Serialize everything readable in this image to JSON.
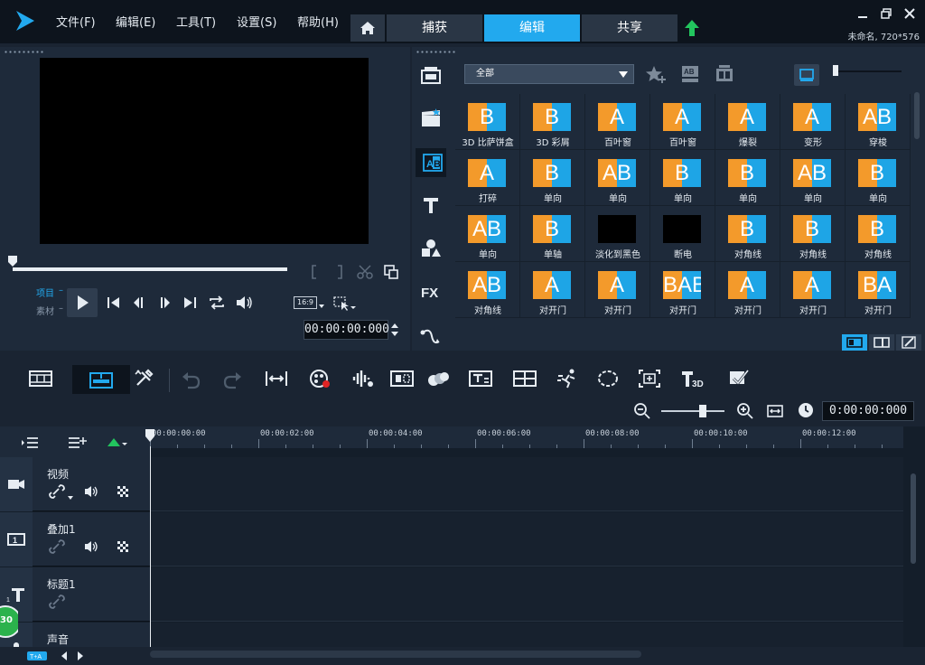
{
  "menu": {
    "file": "文件(F)",
    "edit": "编辑(E)",
    "tools": "工具(T)",
    "settings": "设置(S)",
    "help": "帮助(H)"
  },
  "tabs": {
    "capture": "捕获",
    "edit": "编辑",
    "share": "共享",
    "active": "edit"
  },
  "project": {
    "info": "未命名, 720*576"
  },
  "preview": {
    "mode_project": "项目",
    "mode_clip": "素材",
    "aspect_ratio": "16:9",
    "timecode": "00:00:00:000"
  },
  "library": {
    "category": "全部",
    "active_section": "transitions",
    "items": [
      {
        "label": "3D 比萨饼盒",
        "glyph": "B"
      },
      {
        "label": "3D 彩屑",
        "glyph": "B"
      },
      {
        "label": "百叶窗",
        "glyph": "A"
      },
      {
        "label": "百叶窗",
        "glyph": "A"
      },
      {
        "label": "爆裂",
        "glyph": "A"
      },
      {
        "label": "变形",
        "glyph": "A"
      },
      {
        "label": "穿梭",
        "glyph": "AB"
      },
      {
        "label": "打碎",
        "glyph": "A"
      },
      {
        "label": "单向",
        "glyph": "B"
      },
      {
        "label": "单向",
        "glyph": "AB"
      },
      {
        "label": "单向",
        "glyph": "B"
      },
      {
        "label": "单向",
        "glyph": "B"
      },
      {
        "label": "单向",
        "glyph": "AB"
      },
      {
        "label": "单向",
        "glyph": "B"
      },
      {
        "label": "单向",
        "glyph": "AB"
      },
      {
        "label": "单轴",
        "glyph": "B"
      },
      {
        "label": "淡化到黑色",
        "glyph": ""
      },
      {
        "label": "断电",
        "glyph": ""
      },
      {
        "label": "对角线",
        "glyph": "B"
      },
      {
        "label": "对角线",
        "glyph": "B"
      },
      {
        "label": "对角线",
        "glyph": "B"
      },
      {
        "label": "对角线",
        "glyph": "AB"
      },
      {
        "label": "对开门",
        "glyph": "A"
      },
      {
        "label": "对开门",
        "glyph": "A"
      },
      {
        "label": "对开门",
        "glyph": "BAB"
      },
      {
        "label": "对开门",
        "glyph": "A"
      },
      {
        "label": "对开门",
        "glyph": "A"
      },
      {
        "label": "对开门",
        "glyph": "BA"
      }
    ]
  },
  "toolbar": {
    "timecode": "0:00:00:000"
  },
  "timeline": {
    "ruler": [
      "00:00:00:00",
      "00:00:02:00",
      "00:00:04:00",
      "00:00:06:00",
      "00:00:08:00",
      "00:00:10:00",
      "00:00:12:00"
    ],
    "tracks": [
      {
        "name": "视频",
        "icon": "video-track-icon"
      },
      {
        "name": "叠加1",
        "icon": "overlay-track-icon"
      },
      {
        "name": "标题1",
        "icon": "title-track-icon"
      },
      {
        "name": "声音",
        "icon": "voice-track-icon"
      }
    ],
    "badge": "30"
  },
  "colors": {
    "accent": "#22a9ee",
    "transition_orange": "#f39a2b",
    "transition_blue": "#1ea5e6",
    "upload_green": "#22c55e"
  }
}
